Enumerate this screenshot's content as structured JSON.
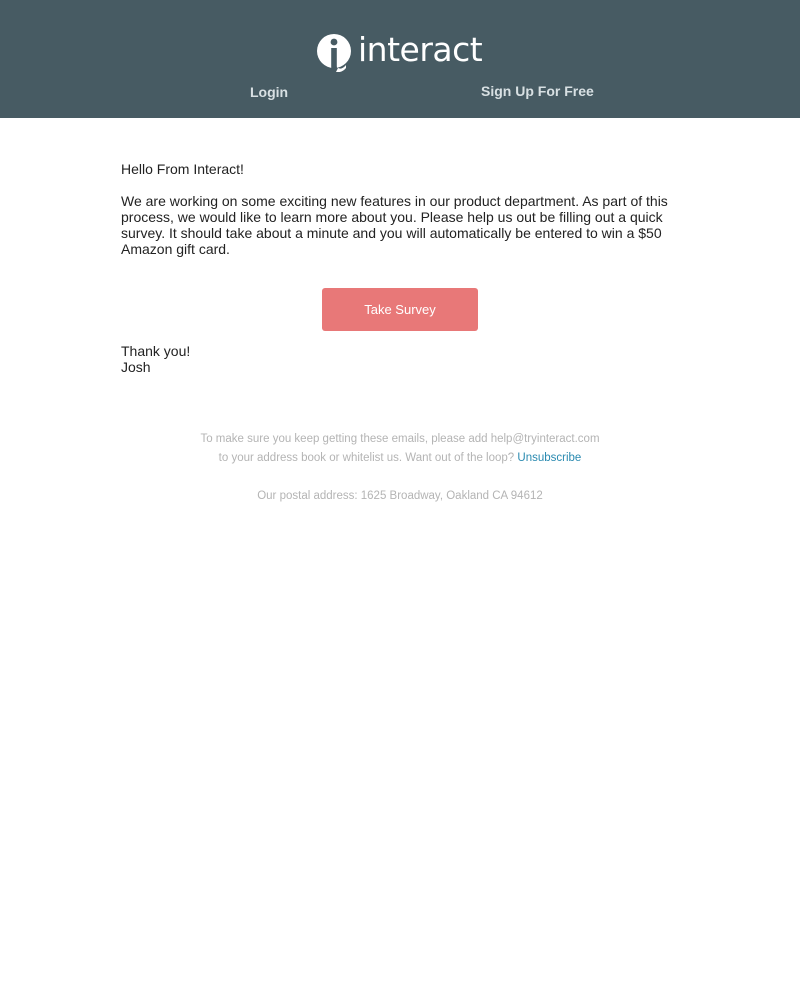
{
  "header": {
    "logo_text": "interact",
    "login_label": "Login",
    "signup_label": "Sign Up For Free"
  },
  "email": {
    "greeting": "Hello From Interact!",
    "body": "We are working on some exciting new features in our product department. As part of this process, we would like to learn more about you. Please help us out be filling out a quick survey. It should take about a minute and you will automatically be entered to win a $50 Amazon gift card.",
    "cta_label": "Take Survey",
    "signoff_line1": "Thank you!",
    "signoff_line2": "Josh"
  },
  "footer": {
    "notice": "To make sure you keep getting these emails, please add help@tryinteract.com to your address book or whitelist us. Want out of the loop?",
    "unsubscribe_label": "Unsubscribe",
    "address": "Our postal address: 1625 Broadway, Oakland CA 94612"
  },
  "colors": {
    "header_bg": "#475b63",
    "cta_bg": "#e87878",
    "link": "#2a8ab0",
    "footer_text": "#b4b4b4"
  },
  "icons": {
    "logo_mark": "interact-logo-icon"
  }
}
